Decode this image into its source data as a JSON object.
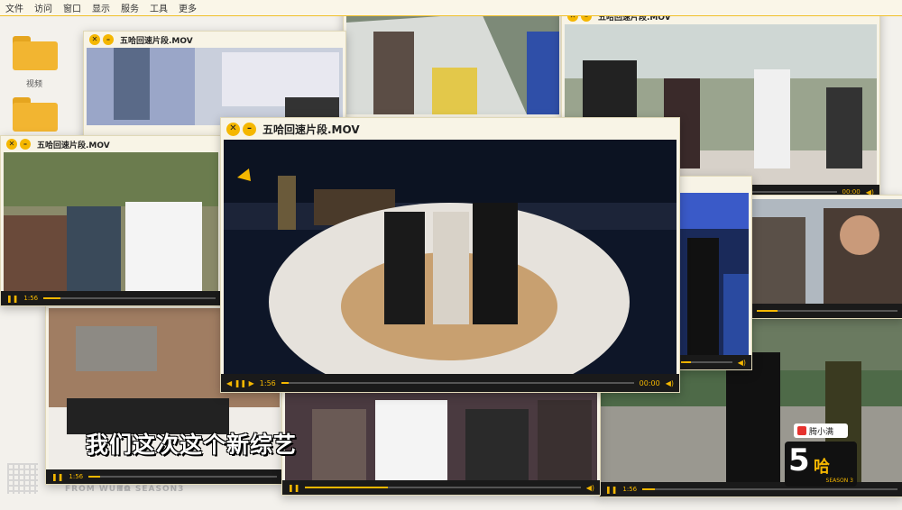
{
  "menubar": [
    "文件",
    "访问",
    "窗口",
    "显示",
    "服务",
    "工具",
    "更多"
  ],
  "desktop": {
    "folder_label": "视频"
  },
  "window_title": "五哈回速片段.MOV",
  "window_title_main": "五哈回速片段.MOV",
  "main_controls": {
    "current": "1:56",
    "total": "00:00"
  },
  "small_controls": {
    "current": "1:56",
    "total": "00:00"
  },
  "subtitle": "我们这次这个新综艺",
  "bottom_tags": [
    "FROM WUHA",
    "TO SEASON3"
  ],
  "brand": {
    "name": "腾小满"
  },
  "logo": {
    "number": "5",
    "text": "哈",
    "season": "SEASON 3"
  },
  "icons": {
    "close": "close-icon",
    "minimize": "minimize-icon",
    "play": "pause-icon",
    "volume": "volume-icon"
  },
  "colors": {
    "accent": "#f5b700",
    "folder": "#f2b531",
    "window_bg": "#f7f3e6"
  }
}
